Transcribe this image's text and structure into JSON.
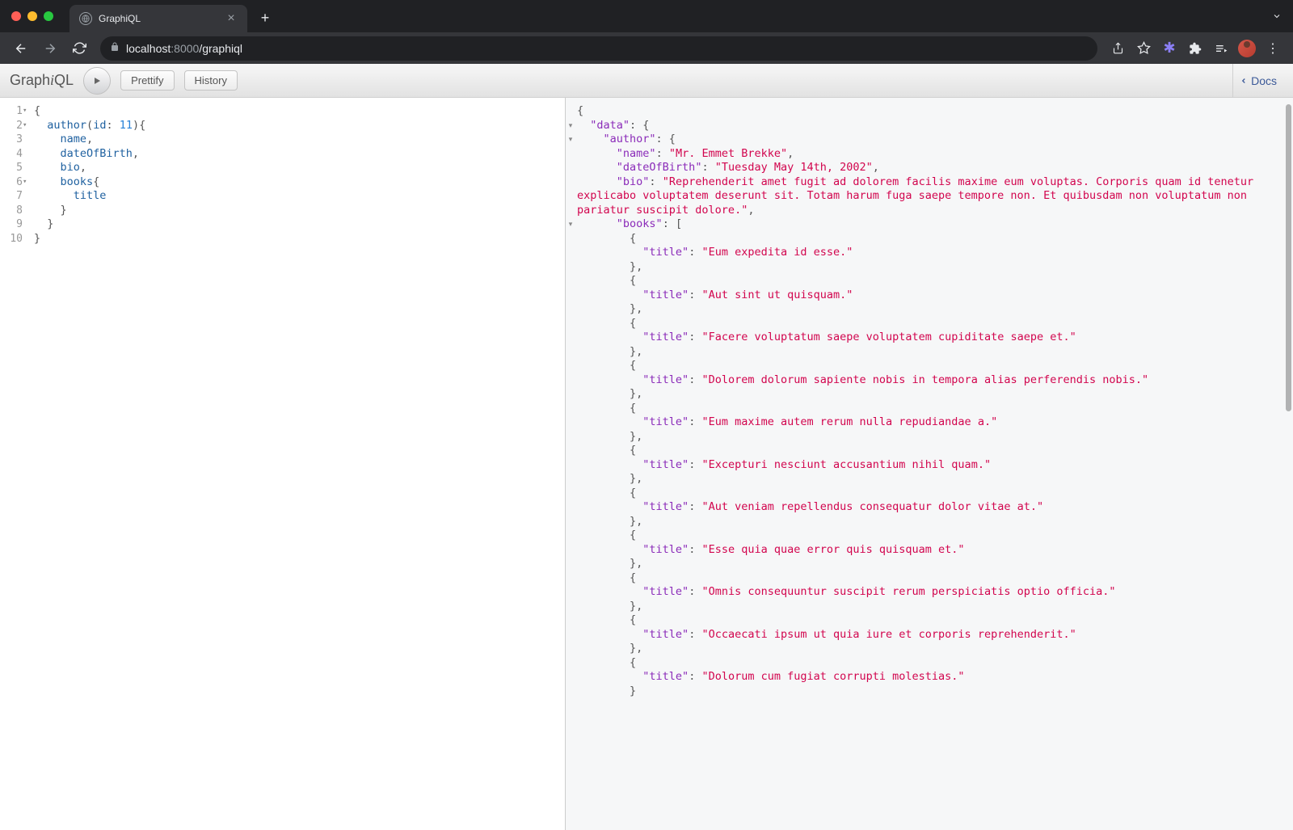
{
  "browser": {
    "tab_title": "GraphiQL",
    "url_host": "localhost",
    "url_port": ":8000",
    "url_path": "/graphiql"
  },
  "toolbar": {
    "logo_prefix": "Graph",
    "logo_i": "i",
    "logo_suffix": "QL",
    "prettify": "Prettify",
    "history": "History",
    "docs": "Docs"
  },
  "query": {
    "lines": [
      "1",
      "2",
      "3",
      "4",
      "5",
      "6",
      "7",
      "8",
      "9",
      "10"
    ],
    "field_author": "author",
    "arg_id": "id",
    "arg_val": "11",
    "field_name": "name",
    "field_dob": "dateOfBirth",
    "field_bio": "bio",
    "field_books": "books",
    "field_title": "title"
  },
  "result": {
    "data": {
      "author": {
        "name": "Mr. Emmet Brekke",
        "dateOfBirth": "Tuesday May 14th, 2002",
        "bio": "Reprehenderit amet fugit ad dolorem facilis maxime eum voluptas. Corporis quam id tenetur explicabo voluptatem deserunt sit. Totam harum fuga saepe tempore non. Et quibusdam non voluptatum non pariatur suscipit dolore.",
        "books": [
          {
            "title": "Eum expedita id esse."
          },
          {
            "title": "Aut sint ut quisquam."
          },
          {
            "title": "Facere voluptatum saepe voluptatem cupiditate saepe et."
          },
          {
            "title": "Dolorem dolorum sapiente nobis in tempora alias perferendis nobis."
          },
          {
            "title": "Eum maxime autem rerum nulla repudiandae a."
          },
          {
            "title": "Excepturi nesciunt accusantium nihil quam."
          },
          {
            "title": "Aut veniam repellendus consequatur dolor vitae at."
          },
          {
            "title": "Esse quia quae error quis quisquam et."
          },
          {
            "title": "Omnis consequuntur suscipit rerum perspiciatis optio officia."
          },
          {
            "title": "Occaecati ipsum ut quia iure et corporis reprehenderit."
          },
          {
            "title": "Dolorum cum fugiat corrupti molestias."
          }
        ]
      }
    }
  }
}
